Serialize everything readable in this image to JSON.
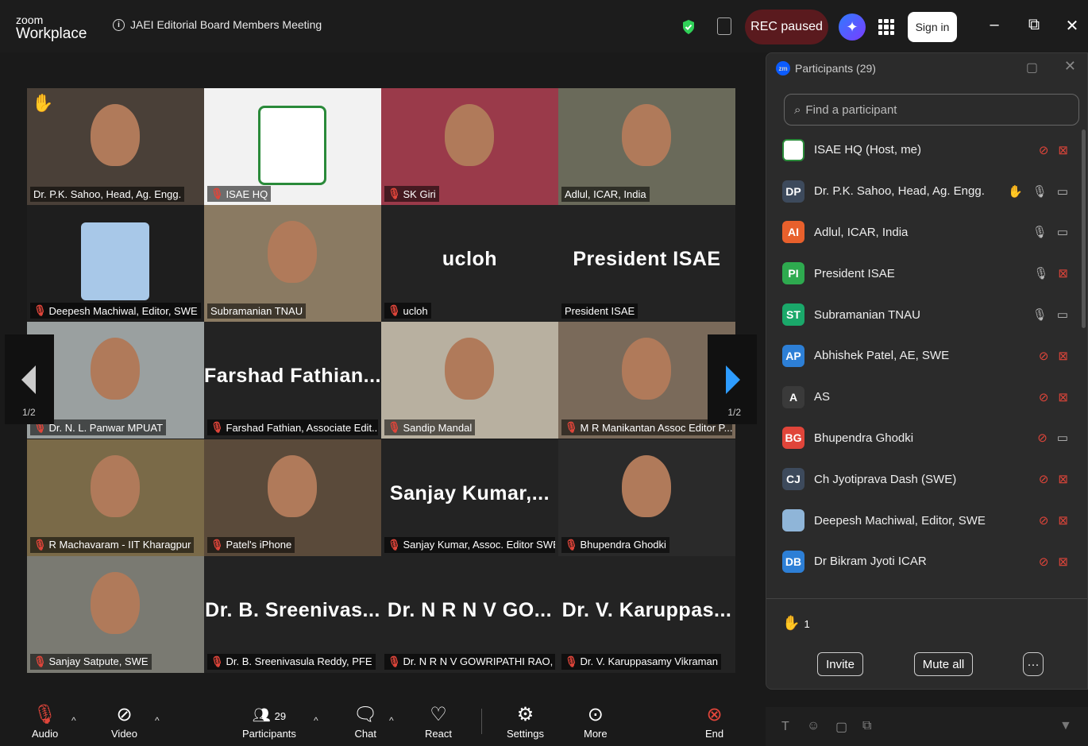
{
  "app": {
    "brand_top": "zoom",
    "brand_bottom": "Workplace",
    "meeting_title": "JAEI Editorial Board Members Meeting"
  },
  "titlebar": {
    "rec_label": "REC paused",
    "signin_label": "Sign in",
    "minimize": "–",
    "restore": "⧉",
    "close": "✕"
  },
  "grid": {
    "tiles": [
      {
        "name": "Dr. P.K. Sahoo, Head, Ag. Engg.",
        "muted": false,
        "video": true,
        "hand": true
      },
      {
        "name": "ISAE HQ",
        "muted": true,
        "video": true,
        "logo": true
      },
      {
        "name": "SK Giri",
        "muted": true,
        "video": true
      },
      {
        "name": "Adlul, ICAR, India",
        "muted": false,
        "video": true
      },
      {
        "name": "Deepesh Machiwal, Editor, SWE",
        "muted": true,
        "video": true,
        "avatar": true
      },
      {
        "name": "Subramanian TNAU",
        "muted": false,
        "video": true
      },
      {
        "name": "ucloh",
        "muted": true,
        "video": false,
        "big": "ucloh"
      },
      {
        "name": "President ISAE",
        "muted": false,
        "video": false,
        "big": "President ISAE",
        "active": true
      },
      {
        "name": "Dr. N. L. Panwar MPUAT",
        "muted": true,
        "video": true
      },
      {
        "name": "Farshad Fathian, Associate Edit...",
        "muted": true,
        "video": false,
        "big": "Farshad  Fathian..."
      },
      {
        "name": "Sandip Mandal",
        "muted": true,
        "video": true
      },
      {
        "name": "M R Manikantan Assoc Editor P...",
        "muted": true,
        "video": true
      },
      {
        "name": "R Machavaram - IIT Kharagpur",
        "muted": true,
        "video": true
      },
      {
        "name": "Patel's iPhone",
        "muted": true,
        "video": true
      },
      {
        "name": "Sanjay Kumar, Assoc. Editor SWE",
        "muted": true,
        "video": false,
        "big": "Sanjay  Kumar,..."
      },
      {
        "name": "Bhupendra Ghodki",
        "muted": true,
        "video": true
      },
      {
        "name": "Sanjay Satpute, SWE",
        "muted": true,
        "video": true
      },
      {
        "name": "Dr.  B. Sreenivasula Reddy, PFE",
        "muted": true,
        "video": false,
        "big": "Dr.  B. Sreenivas..."
      },
      {
        "name": "Dr. N R N V GOWRIPATHI RAO, ...",
        "muted": true,
        "video": false,
        "big": "Dr. N R N V GO..."
      },
      {
        "name": "Dr. V. Karuppasamy Vikraman",
        "muted": true,
        "video": false,
        "big": "Dr.  V.  Karuppas..."
      }
    ],
    "page_left": "1/2",
    "page_right": "1/2"
  },
  "toolbar": {
    "audio": "Audio",
    "video": "Video",
    "participants": "Participants",
    "participants_count": "29",
    "chat": "Chat",
    "react": "React",
    "settings": "Settings",
    "more": "More",
    "end": "End"
  },
  "panel": {
    "title": "Participants (29)",
    "search_placeholder": "Find a participant",
    "participants": [
      {
        "initials": "",
        "name": "ISAE HQ (Host, me)",
        "color": "#ffffff",
        "mic": "off",
        "cam": "off",
        "logo": true
      },
      {
        "initials": "DP",
        "name": "Dr. P.K. Sahoo, Head, Ag. Engg.",
        "color": "#3d4a5c",
        "mic": "on",
        "cam": "on",
        "hand": true
      },
      {
        "initials": "AI",
        "name": "Adlul, ICAR, India",
        "color": "#e8602c",
        "mic": "on",
        "cam": "on"
      },
      {
        "initials": "PI",
        "name": "President ISAE",
        "color": "#2eaa4f",
        "mic": "on",
        "cam": "off"
      },
      {
        "initials": "ST",
        "name": "Subramanian TNAU",
        "color": "#1aa86a",
        "mic": "on",
        "cam": "on"
      },
      {
        "initials": "AP",
        "name": "Abhishek Patel, AE, SWE",
        "color": "#2d7fd6",
        "mic": "off",
        "cam": "off"
      },
      {
        "initials": "A",
        "name": "AS",
        "color": "#3a3a3a",
        "mic": "off",
        "cam": "off"
      },
      {
        "initials": "BG",
        "name": "Bhupendra Ghodki",
        "color": "#e0453a",
        "mic": "off",
        "cam": "on"
      },
      {
        "initials": "CJ",
        "name": "Ch Jyotiprava Dash (SWE)",
        "color": "#3d4a5c",
        "mic": "off",
        "cam": "off"
      },
      {
        "initials": "",
        "name": "Deepesh Machiwal, Editor, SWE",
        "color": "#8fb5d8",
        "mic": "off",
        "cam": "off",
        "photo": true
      },
      {
        "initials": "DB",
        "name": "Dr Bikram Jyoti ICAR",
        "color": "#2d7fd6",
        "mic": "off",
        "cam": "off"
      }
    ],
    "raised_hands": "1",
    "invite_label": "Invite",
    "mute_all_label": "Mute all",
    "more_label": "···"
  },
  "chat_bar": {
    "format": "T",
    "emoji": "☺",
    "file": "▢",
    "screenshot": "⧉",
    "send": "▼"
  },
  "colors": {
    "accent": "#0b5cff",
    "muted_red": "#e0453a",
    "active_speaker": "#30d158"
  }
}
